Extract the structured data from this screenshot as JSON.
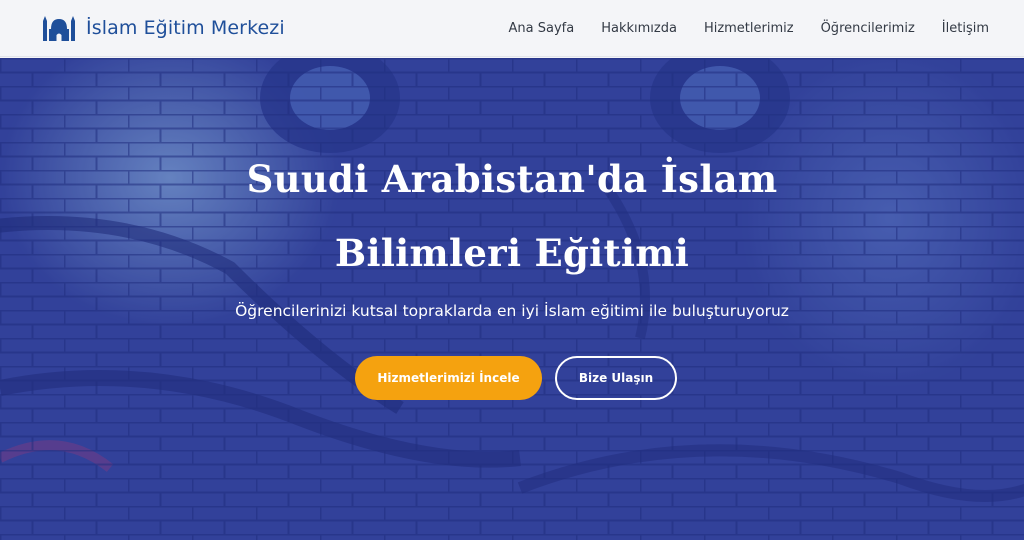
{
  "brand": {
    "name": "İslam Eğitim Merkezi",
    "icon": "mosque-icon",
    "color": "#1f4f9a"
  },
  "nav": {
    "items": [
      {
        "label": "Ana Sayfa"
      },
      {
        "label": "Hakkımızda"
      },
      {
        "label": "Hizmetlerimiz"
      },
      {
        "label": "Öğrencilerimiz"
      },
      {
        "label": "İletişim"
      }
    ]
  },
  "hero": {
    "title_line1": "Suudi Arabistan'da İslam",
    "title_line2": "Bilimleri Eğitimi",
    "subtitle": "Öğrencilerinizi kutsal topraklarda en iyi İslam eğitimi ile buluşturuyoruz",
    "primary_button": "Hizmetlerimizi İncele",
    "secondary_button": "Bize Ulaşın",
    "accent_color": "#f5a20f",
    "overlay_color": "#2d3a93"
  }
}
